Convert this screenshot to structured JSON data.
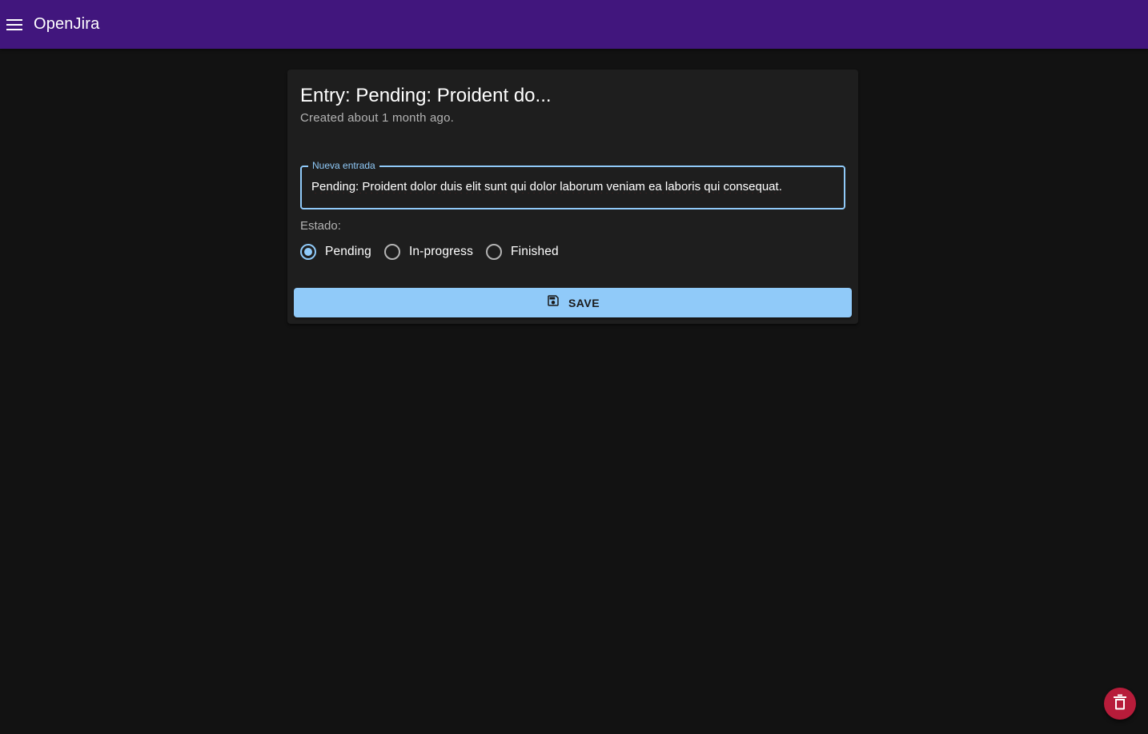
{
  "appbar": {
    "title": "OpenJira",
    "menu_icon": "menu-icon",
    "color": "#41167d"
  },
  "entry": {
    "title": "Entry: Pending: Proident do...",
    "subtitle": "Created about 1 month ago.",
    "field_label": "Nueva entrada",
    "field_value": "Pending: Proident dolor duis elit sunt qui dolor laborum veniam ea laboris qui consequat."
  },
  "status": {
    "label": "Estado:",
    "options": [
      {
        "label": "Pending",
        "checked": true
      },
      {
        "label": "In-progress",
        "checked": false
      },
      {
        "label": "Finished",
        "checked": false
      }
    ]
  },
  "actions": {
    "save_label": "SAVE",
    "save_icon": "save-icon",
    "delete_icon": "delete-icon"
  },
  "colors": {
    "accent": "#90caf9",
    "danger": "#b71c3a",
    "background": "#121212",
    "surface": "#1e1e1e"
  }
}
